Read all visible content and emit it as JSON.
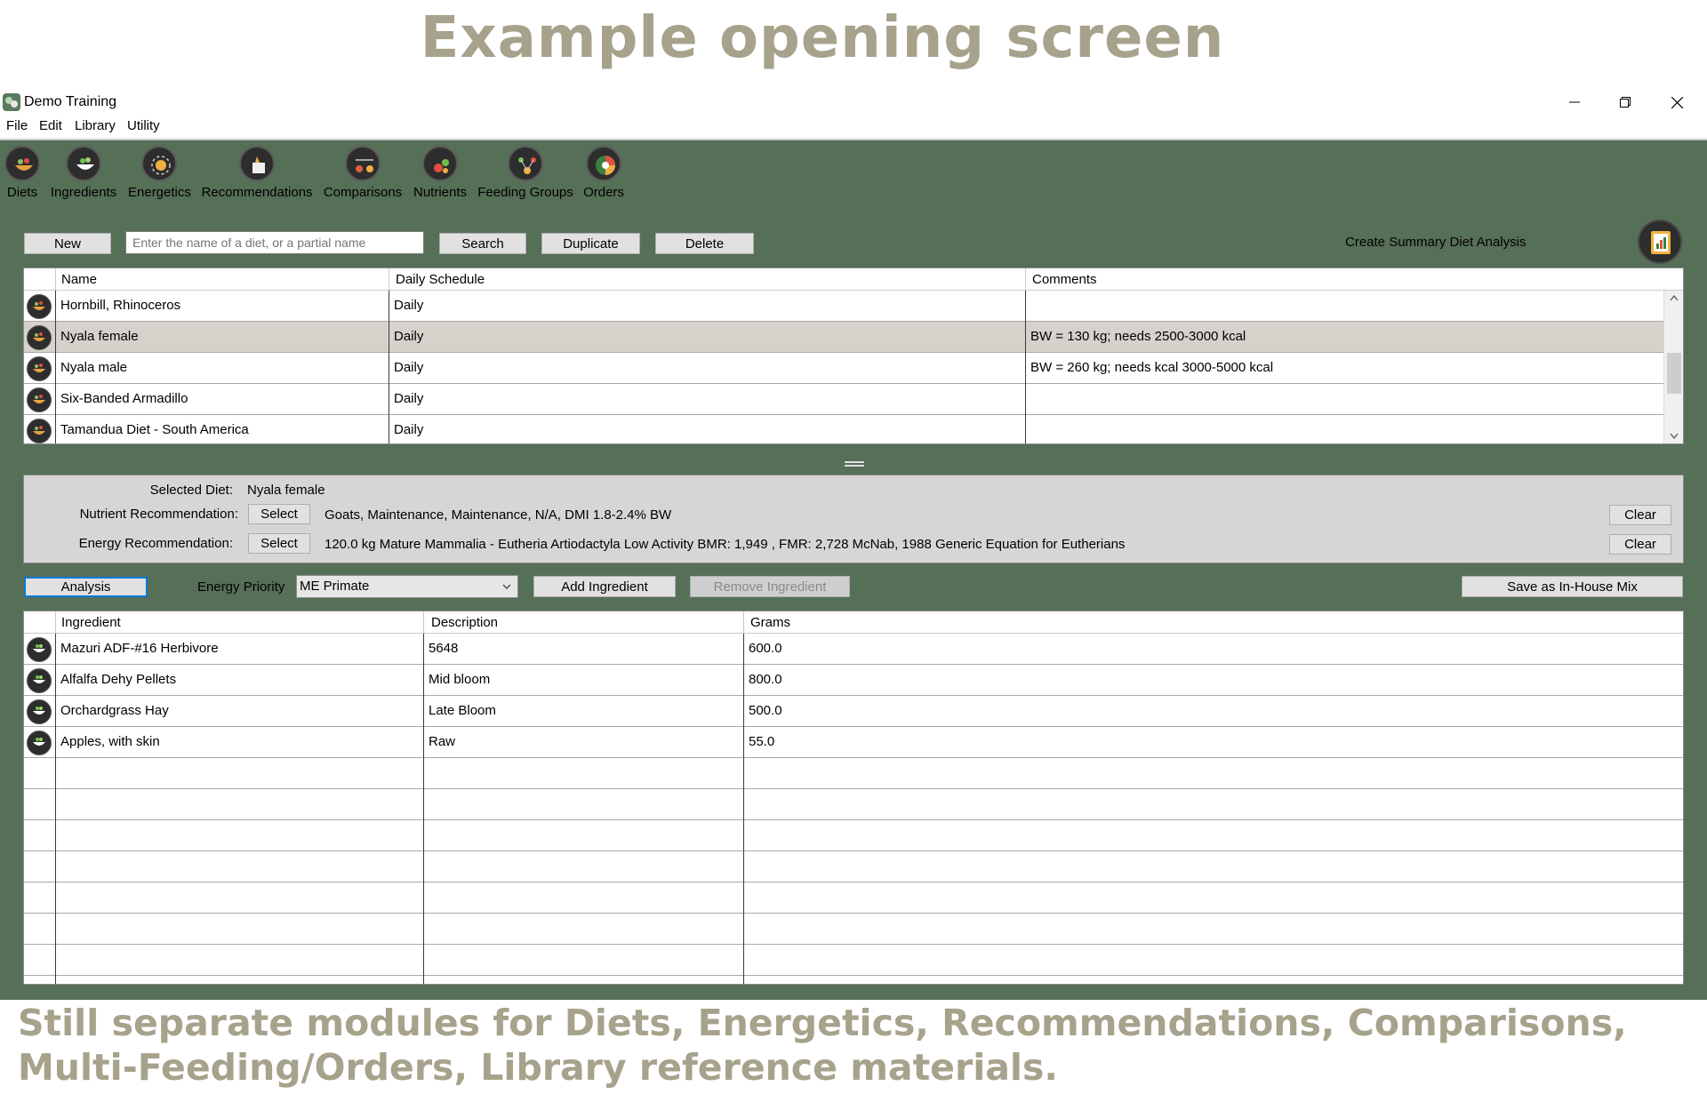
{
  "heading": "Example opening screen",
  "caption": "Still separate modules for Diets, Energetics, Recommendations, Comparisons, Multi-Feeding/Orders, Library reference materials.",
  "window": {
    "title": "Demo Training",
    "controls": [
      "minimize",
      "restore",
      "close"
    ]
  },
  "menu": [
    "File",
    "Edit",
    "Library",
    "Utility"
  ],
  "toolbar": [
    {
      "label": "Diets",
      "icon": "diets-icon"
    },
    {
      "label": "Ingredients",
      "icon": "ingredients-icon"
    },
    {
      "label": "Energetics",
      "icon": "energetics-icon"
    },
    {
      "label": "Recommendations",
      "icon": "recommendations-icon"
    },
    {
      "label": "Comparisons",
      "icon": "comparisons-icon"
    },
    {
      "label": "Nutrients",
      "icon": "nutrients-icon"
    },
    {
      "label": "Feeding Groups",
      "icon": "feeding-groups-icon"
    },
    {
      "label": "Orders",
      "icon": "orders-icon"
    }
  ],
  "diet_actions": {
    "new": "New",
    "search_placeholder": "Enter the name of a diet, or a partial name",
    "search": "Search",
    "duplicate": "Duplicate",
    "delete": "Delete",
    "summary": "Create Summary Diet Analysis"
  },
  "diets_table": {
    "columns": [
      "Name",
      "Daily Schedule",
      "Comments"
    ],
    "rows": [
      {
        "name": "Hornbill, Rhinoceros",
        "schedule": "Daily",
        "comments": ""
      },
      {
        "name": "Nyala female",
        "schedule": "Daily",
        "comments": "BW = 130 kg; needs 2500-3000 kcal"
      },
      {
        "name": "Nyala male",
        "schedule": "Daily",
        "comments": "BW = 260 kg; needs  kcal 3000-5000 kcal"
      },
      {
        "name": "Six-Banded Armadillo",
        "schedule": "Daily",
        "comments": ""
      },
      {
        "name": "Tamandua Diet - South America",
        "schedule": "Daily",
        "comments": ""
      }
    ],
    "selected_row": 1
  },
  "selection_panel": {
    "selected_diet_label": "Selected Diet:",
    "selected_diet": "Nyala female",
    "nutrient_label": "Nutrient Recommendation:",
    "nutrient_value": "Goats, Maintenance, Maintenance, N/A, DMI 1.8-2.4% BW",
    "energy_label": "Energy Recommendation:",
    "energy_value": "120.0 kg Mature Mammalia - Eutheria Artiodactyla Low Activity BMR: 1,949 , FMR: 2,728 McNab, 1988 Generic Equation for Eutherians",
    "select": "Select",
    "clear": "Clear"
  },
  "ingredient_actions": {
    "analysis": "Analysis",
    "energy_priority_label": "Energy Priority",
    "energy_priority_value": "ME Primate",
    "add": "Add Ingredient",
    "remove": "Remove Ingredient",
    "save_mix": "Save as In-House Mix"
  },
  "ingredients_table": {
    "columns": [
      "Ingredient",
      "Description",
      "Grams"
    ],
    "rows": [
      {
        "ingredient": "Mazuri ADF-#16 Herbivore",
        "description": "5648",
        "grams": "600.0"
      },
      {
        "ingredient": "Alfalfa Dehy Pellets",
        "description": "Mid bloom",
        "grams": "800.0"
      },
      {
        "ingredient": "Orchardgrass Hay",
        "description": "Late Bloom",
        "grams": "500.0"
      },
      {
        "ingredient": "Apples, with skin",
        "description": "Raw",
        "grams": "55.0"
      }
    ],
    "empty_rows": 7
  }
}
